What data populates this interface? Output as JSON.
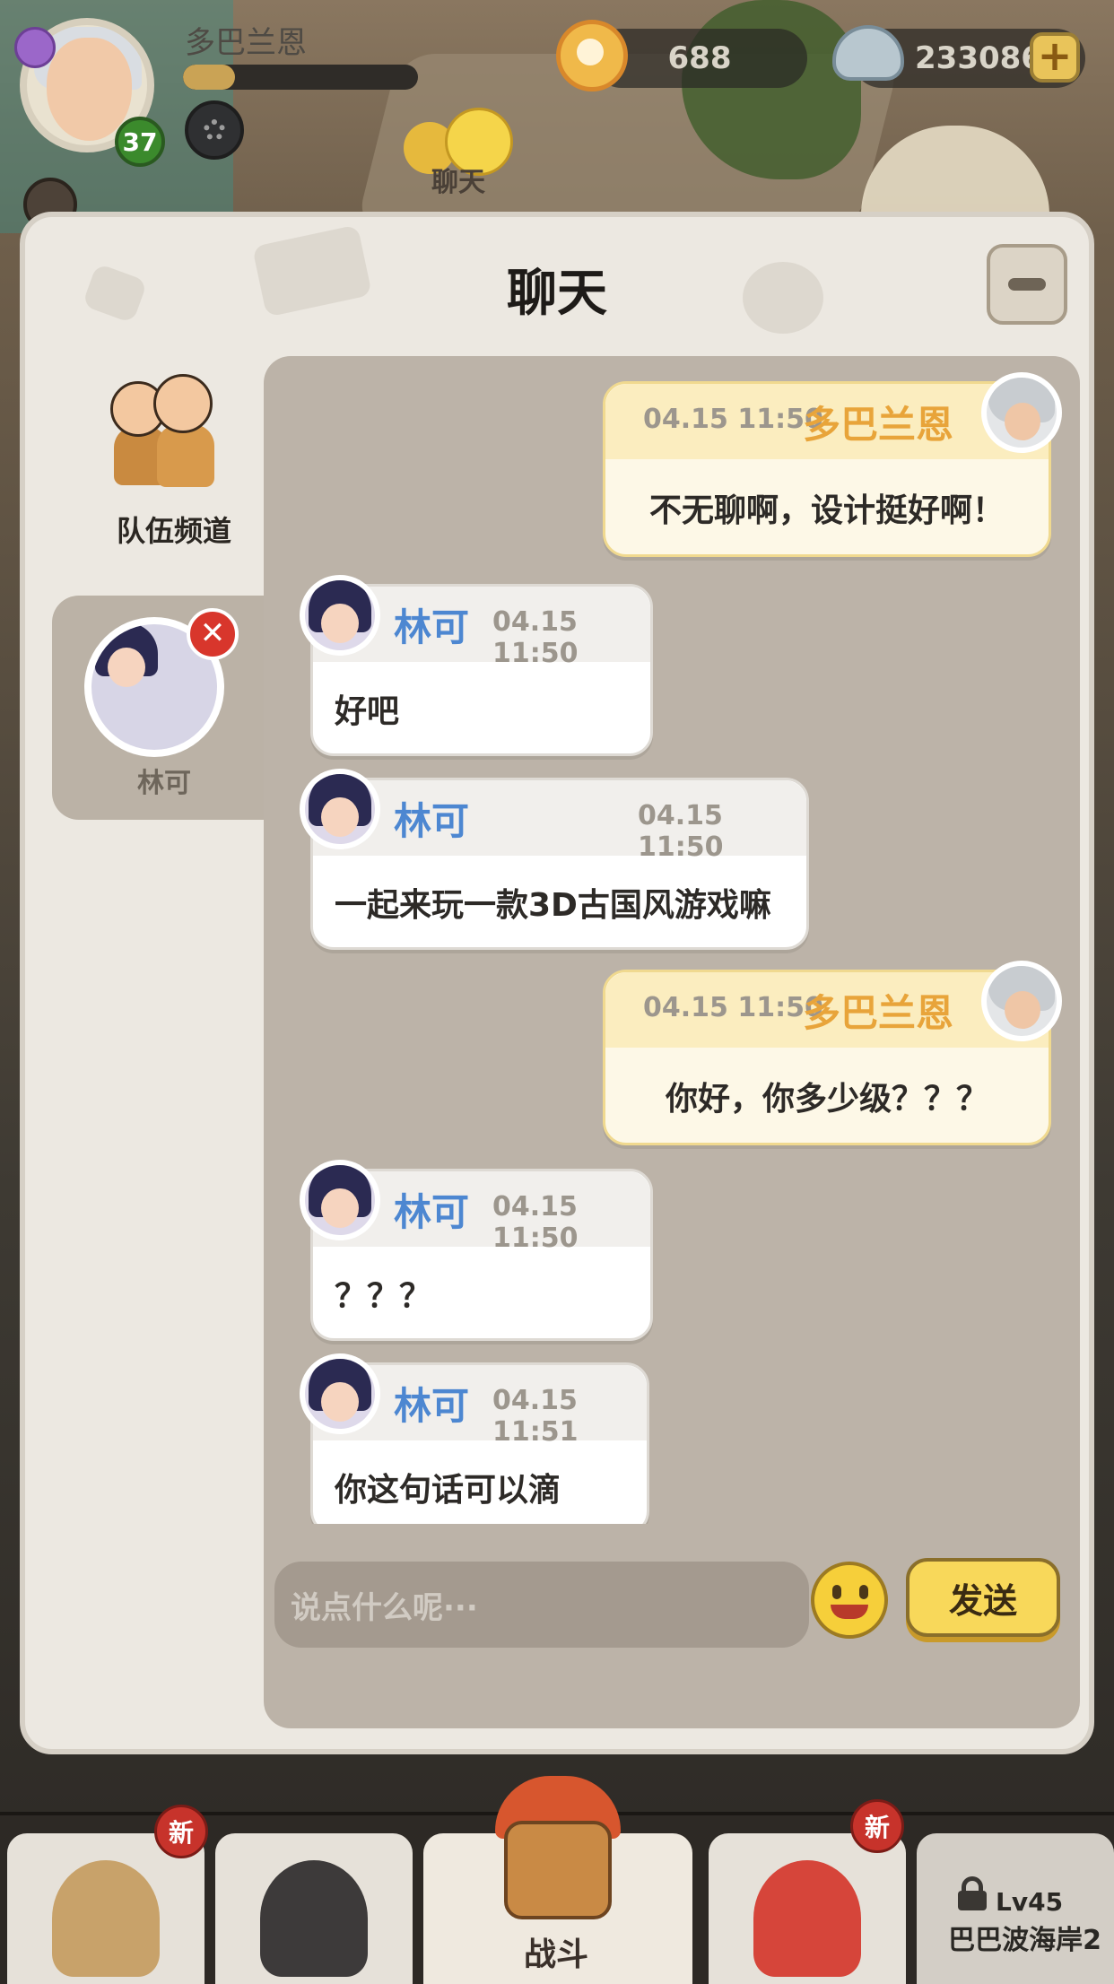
{
  "hud": {
    "player_name": "多巴兰恩",
    "level": "37",
    "xp_progress_percent": 22,
    "pearls": "688",
    "shells": "233086",
    "chat_button_label": "聊天"
  },
  "panel": {
    "title": "聊天",
    "channels": [
      {
        "label": "队伍频道"
      },
      {
        "label": "林可"
      }
    ],
    "input_placeholder": "说点什么呢···",
    "send_label": "发送"
  },
  "messages": [
    {
      "side": "mine",
      "name": "多巴兰恩",
      "time": "04.15 11:50",
      "text": "不无聊啊，设计挺好啊！"
    },
    {
      "side": "theirs",
      "name": "林可",
      "time": "04.15 11:50",
      "text": "好吧"
    },
    {
      "side": "theirs",
      "name": "林可",
      "time": "04.15 11:50",
      "text": "一起来玩一款3D古国风游戏嘛"
    },
    {
      "side": "mine",
      "name": "多巴兰恩",
      "time": "04.15 11:50",
      "text": "你好，你多少级？？？"
    },
    {
      "side": "theirs",
      "name": "林可",
      "time": "04.15 11:50",
      "text": "？？？"
    },
    {
      "side": "theirs",
      "name": "林可",
      "time": "04.15 11:51",
      "text": "你这句话可以滴"
    }
  ],
  "bottom_nav": {
    "new_badge": "新",
    "battle_label": "战斗",
    "locked_level": "Lv45",
    "locked_area": "巴巴波海岸2"
  },
  "colors": {
    "mine_name": "#e8a43a",
    "theirs_name": "#4d87d1",
    "close_badge": "#d8362c"
  }
}
